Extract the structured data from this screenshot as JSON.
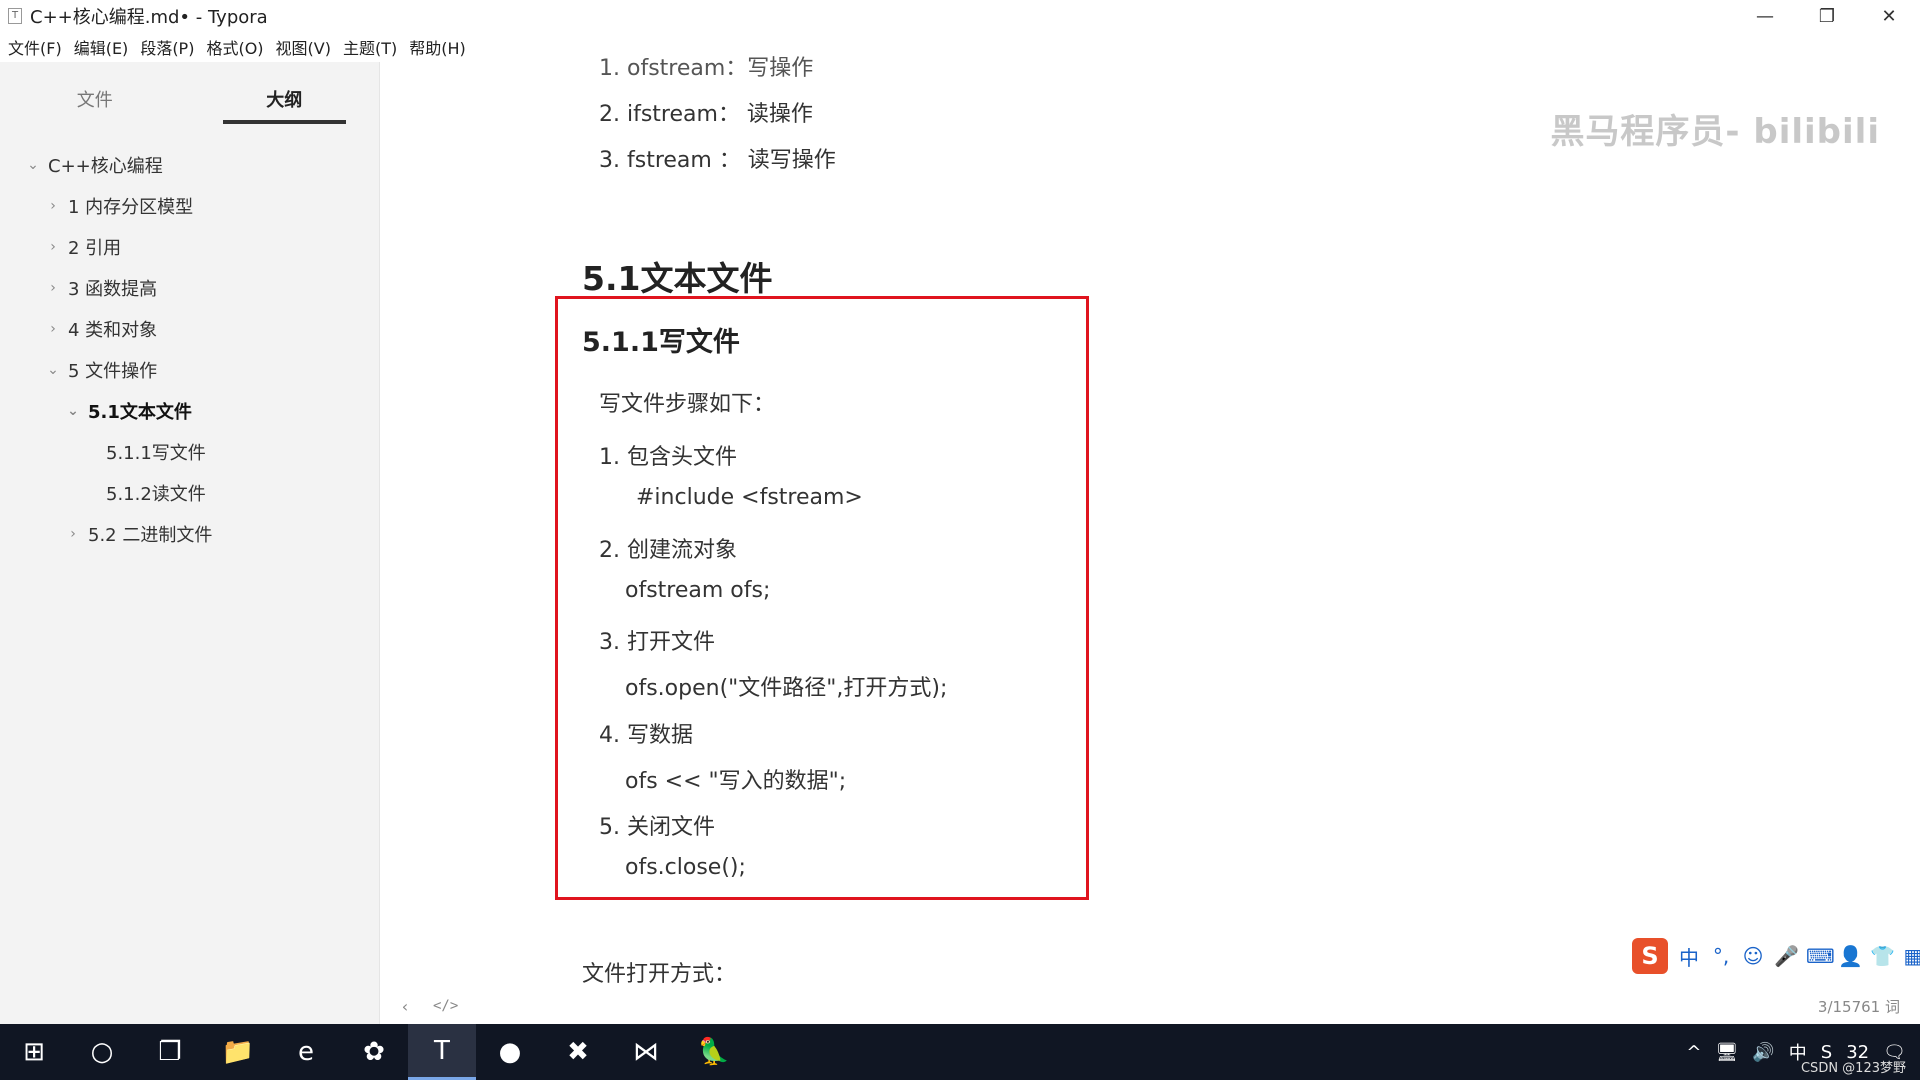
{
  "window": {
    "title": "C++核心编程.md• - Typora",
    "controls": [
      "—",
      "❐",
      "✕"
    ]
  },
  "menu": [
    "文件(F)",
    "编辑(E)",
    "段落(P)",
    "格式(O)",
    "视图(V)",
    "主题(T)",
    "帮助(H)"
  ],
  "sidebar": {
    "tabs": [
      "文件",
      "大纲"
    ],
    "outline": [
      {
        "label": "C++核心编程",
        "chev": "⌄"
      },
      {
        "label": "1 内存分区模型",
        "chev": "›"
      },
      {
        "label": "2 引用",
        "chev": "›"
      },
      {
        "label": "3 函数提高",
        "chev": "›"
      },
      {
        "label": "4 类和对象",
        "chev": "›"
      },
      {
        "label": "5 文件操作",
        "chev": "⌄"
      },
      {
        "label": "5.1文本文件",
        "chev": "⌄"
      },
      {
        "label": "5.1.1写文件",
        "chev": ""
      },
      {
        "label": "5.1.2读文件",
        "chev": ""
      },
      {
        "label": "5.2 二进制文件",
        "chev": "›"
      }
    ]
  },
  "doc": {
    "top_items": [
      "1. ofstream：写操作",
      "2. ifstream： 读操作",
      "3. fstream ： 读写操作"
    ],
    "h2": "5.1文本文件",
    "h3": "5.1.1写文件",
    "intro": "写文件步骤如下：",
    "steps": [
      {
        "title": "1. 包含头文件",
        "code": "#include <fstream>"
      },
      {
        "title": "2. 创建流对象",
        "code": "ofstream ofs;"
      },
      {
        "title": "3. 打开文件",
        "code": "ofs.open(\"文件路径\",打开方式);"
      },
      {
        "title": "4. 写数据",
        "code": "ofs << \"写入的数据\";"
      },
      {
        "title": "5. 关闭文件",
        "code": "ofs.close();"
      }
    ],
    "after": "文件打开方式："
  },
  "watermark": "黑马程序员- bilibili",
  "footer": {
    "back": "‹",
    "source": "</>",
    "word_count": "3/15761 词"
  },
  "ime": {
    "logo": "S",
    "items": [
      "中",
      "°,",
      "☺",
      "🎤",
      "⌨",
      "👤",
      "👕",
      "▦"
    ]
  },
  "taskbar": {
    "icons": [
      "⊞",
      "○",
      "❐",
      "📁",
      "e",
      "✿",
      "T",
      "●",
      "✖",
      "⋈",
      "🦜"
    ],
    "tray": [
      "^",
      "🖥",
      "🔊",
      "中",
      "S",
      "32",
      "🗨"
    ],
    "credit": "CSDN @123梦野"
  }
}
